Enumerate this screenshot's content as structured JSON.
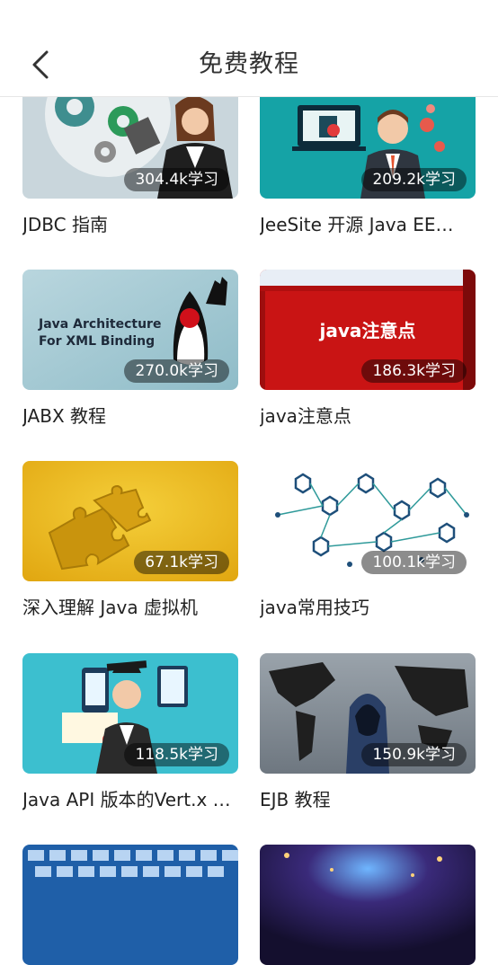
{
  "header": {
    "title": "免费教程",
    "back_icon": "chevron-left-icon"
  },
  "courses": [
    {
      "name": "JDBC 指南",
      "learners": "304.4k学习"
    },
    {
      "name": "JeeSite 开源 Java EE…",
      "learners": "209.2k学习"
    },
    {
      "name": "JABX 教程",
      "learners": "270.0k学习",
      "thumb_text": [
        "Java Architecture",
        "For XML Binding"
      ]
    },
    {
      "name": "java注意点",
      "learners": "186.3k学习",
      "thumb_text": [
        "java注意点"
      ]
    },
    {
      "name": "深入理解 Java 虚拟机",
      "learners": "67.1k学习"
    },
    {
      "name": "java常用技巧",
      "learners": "100.1k学习"
    },
    {
      "name": "Java API 版本的Vert.x …",
      "learners": "118.5k学习"
    },
    {
      "name": "EJB 教程",
      "learners": "150.9k学习"
    },
    {
      "name": "",
      "learners": ""
    },
    {
      "name": "",
      "learners": ""
    }
  ]
}
